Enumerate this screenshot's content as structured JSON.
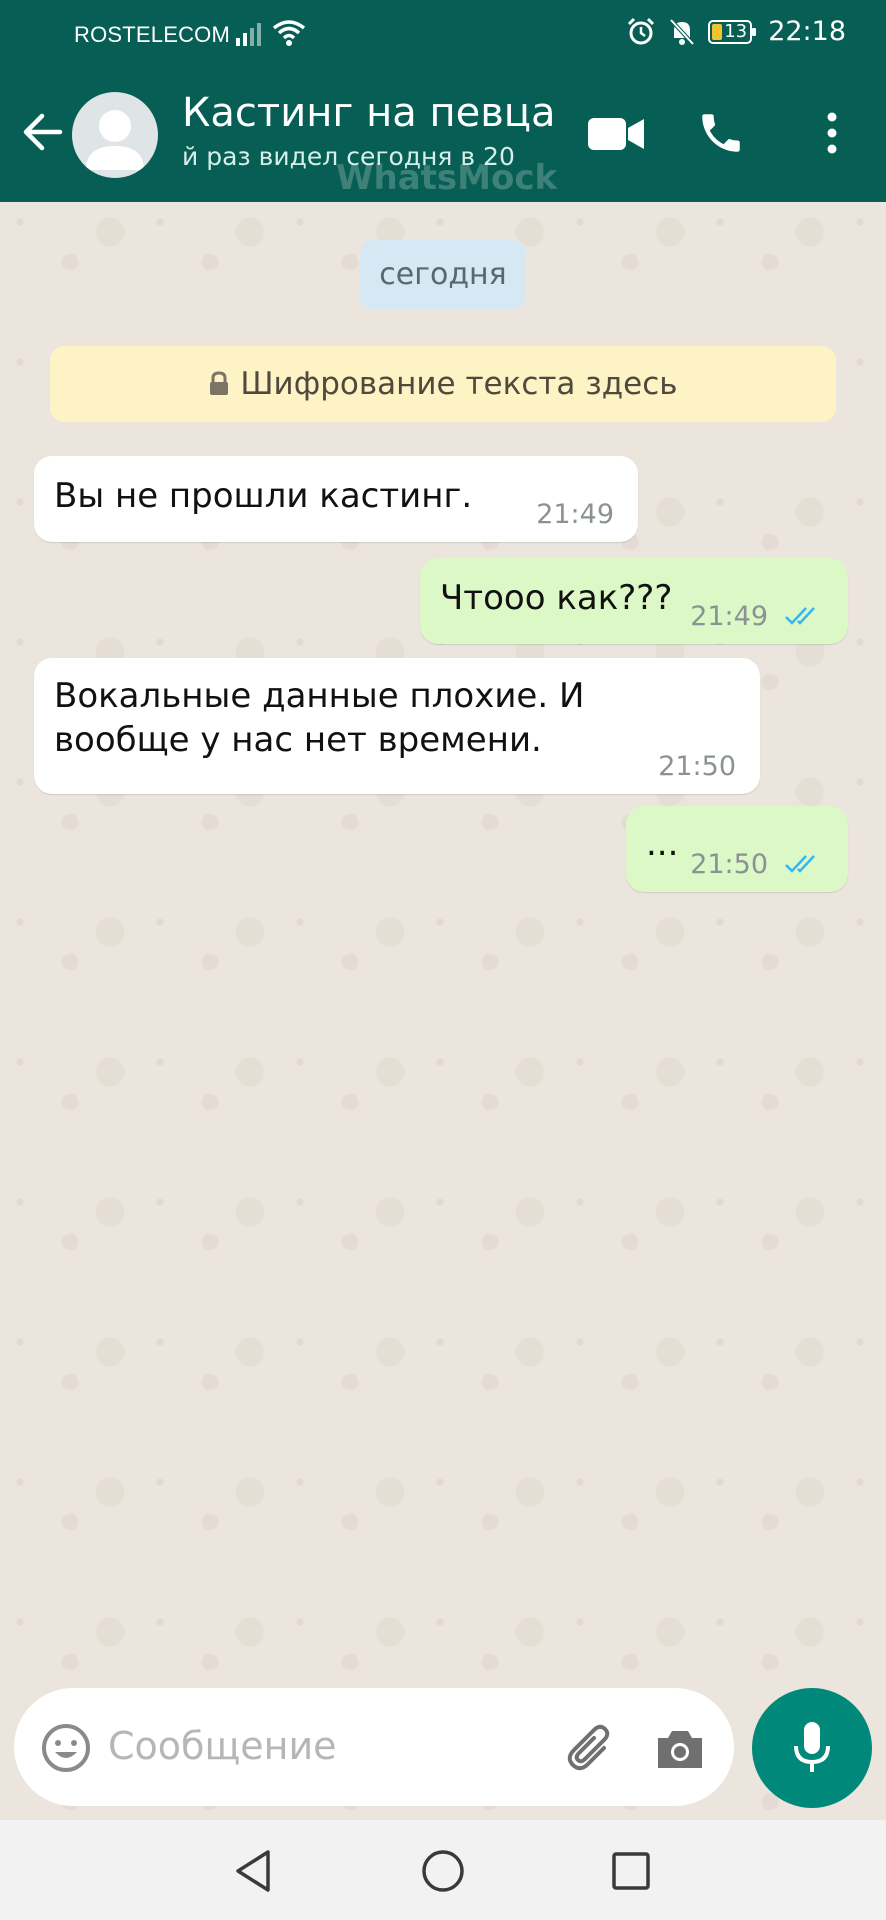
{
  "status": {
    "carrier": "ROSTELECOM",
    "battery": "13",
    "time": "22:18"
  },
  "header": {
    "title": "Кастинг на певца",
    "subtitle": "й раз видел сегодня в 20",
    "watermark": "WhatsMock"
  },
  "chat": {
    "date_chip": "сегодня",
    "encryption_notice": "Шифрование текста здесь",
    "messages": [
      {
        "direction": "in",
        "text": "Вы не прошли кастинг.",
        "time": "21:49"
      },
      {
        "direction": "out",
        "text": "Чтооо как???",
        "time": "21:49",
        "read": true
      },
      {
        "direction": "in",
        "line1": "Вокальные данные плохие. И",
        "line2": "вообще у нас нет времени.",
        "time": "21:50"
      },
      {
        "direction": "out",
        "text": "...",
        "time": "21:50",
        "read": true
      }
    ]
  },
  "composer": {
    "placeholder": "Сообщение"
  },
  "icons": [
    "back-arrow-icon",
    "avatar-icon",
    "video-call-icon",
    "phone-icon",
    "more-vert-icon",
    "lock-icon",
    "double-check-icon",
    "emoji-icon",
    "attach-icon",
    "camera-icon",
    "mic-icon",
    "nav-back-icon",
    "nav-home-icon",
    "nav-recent-icon"
  ],
  "colors": {
    "header": "#075e54",
    "incoming_bubble": "#ffffff",
    "outgoing_bubble": "#dcf8c6",
    "tick_read": "#34b7f1",
    "mic_button": "#00897b",
    "chat_background": "#ece5dd"
  }
}
